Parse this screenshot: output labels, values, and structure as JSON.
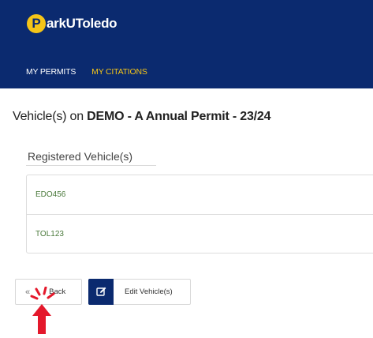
{
  "header": {
    "logo_letter": "P",
    "logo_text": "arkUToledo",
    "nav": [
      {
        "label": "MY PERMITS"
      },
      {
        "label": "MY CITATIONS"
      }
    ]
  },
  "main": {
    "title_prefix": "Vehicle(s) on ",
    "title_permit": "DEMO - A Annual Permit - 23/24",
    "panel_title": "Registered Vehicle(s)",
    "vehicles": [
      "EDO456",
      "TOL123"
    ]
  },
  "actions": {
    "back_icon": "«",
    "back_label": "Back",
    "edit_label": "Edit Vehicle(s)"
  },
  "colors": {
    "header_bg": "#0b2a6f",
    "accent_yellow": "#f5c518",
    "plate_green": "#4b7a3c",
    "click_marker": "#e4182b"
  },
  "icons": {
    "edit": "pencil-square-icon",
    "back": "double-chevron-left-icon",
    "cursor": "click-pointer-icon"
  }
}
